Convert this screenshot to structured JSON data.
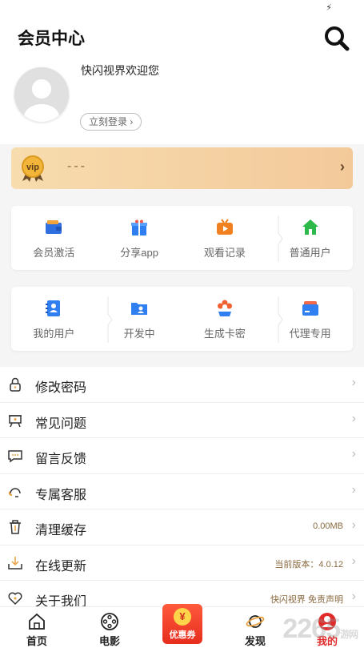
{
  "status": {
    "icon": "bolt-icon"
  },
  "header": {
    "title": "会员中心",
    "search_icon": "search-icon"
  },
  "profile": {
    "welcome": "快闪视界欢迎您",
    "login_button": "立刻登录"
  },
  "vip": {
    "badge_text": "vip",
    "value": "---"
  },
  "grid1": [
    {
      "label": "会员激活",
      "icon": "wallet-icon",
      "color": "#2f6fe0"
    },
    {
      "label": "分享app",
      "icon": "gift-icon",
      "color": "#2f7ff0"
    },
    {
      "label": "观看记录",
      "icon": "tv-icon",
      "color": "#f08020"
    },
    {
      "label": "普通用户",
      "icon": "home-icon",
      "color": "#2db84a"
    }
  ],
  "grid2": [
    {
      "label": "我的用户",
      "icon": "contacts-icon",
      "color": "#2f7ff0"
    },
    {
      "label": "开发中",
      "icon": "folder-user-icon",
      "color": "#2f7ff0"
    },
    {
      "label": "生成卡密",
      "icon": "flower-location-icon",
      "color": "#f06030"
    },
    {
      "label": "代理专用",
      "icon": "card-icon",
      "color": "#2f7ff0"
    }
  ],
  "menu": [
    {
      "label": "修改密码",
      "icon": "lock-icon",
      "right": ""
    },
    {
      "label": "常见问题",
      "icon": "easel-icon",
      "right": ""
    },
    {
      "label": "留言反馈",
      "icon": "chat-icon",
      "right": ""
    },
    {
      "label": "专属客服",
      "icon": "headset-icon",
      "right": ""
    },
    {
      "label": "清理缓存",
      "icon": "trash-icon",
      "right": "0.00MB"
    },
    {
      "label": "在线更新",
      "icon": "download-icon",
      "right": "当前版本：4.0.12"
    },
    {
      "label": "关于我们",
      "icon": "heart-icon",
      "right": "快闪视界 免责声明"
    }
  ],
  "tabs": [
    {
      "label": "首页",
      "icon": "home-outline-icon"
    },
    {
      "label": "电影",
      "icon": "film-reel-icon"
    },
    {
      "label": "优惠券",
      "icon": "coupon-icon"
    },
    {
      "label": "发现",
      "icon": "planet-icon"
    },
    {
      "label": "我的",
      "icon": "user-icon"
    }
  ],
  "watermark": {
    "text": "2265",
    "suffix": "游网"
  }
}
